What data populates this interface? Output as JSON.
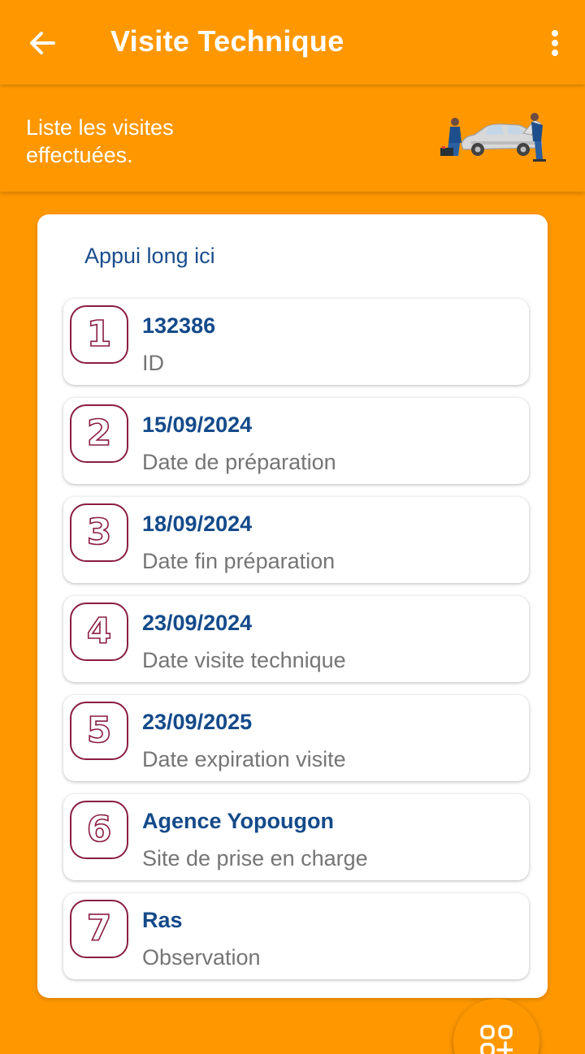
{
  "app_bar": {
    "title": "Visite Technique",
    "back_icon": "arrow-left-icon",
    "menu_icon": "more-vertical-icon"
  },
  "banner": {
    "text": "Liste les visites effectuées.",
    "illustration": "car-mechanics-illustration"
  },
  "card": {
    "hint": "Appui long ici",
    "items": [
      {
        "number": "1",
        "value": "132386",
        "label": "ID"
      },
      {
        "number": "2",
        "value": "15/09/2024",
        "label": "Date de préparation"
      },
      {
        "number": "3",
        "value": "18/09/2024",
        "label": "Date fin préparation"
      },
      {
        "number": "4",
        "value": "23/09/2024",
        "label": "Date visite technique"
      },
      {
        "number": "5",
        "value": "23/09/2025",
        "label": "Date expiration visite"
      },
      {
        "number": "6",
        "value": "Agence Yopougon",
        "label": "Site de prise en charge"
      },
      {
        "number": "7",
        "value": "Ras",
        "label": "Observation"
      }
    ]
  },
  "fab": {
    "icon": "grid-add-icon"
  },
  "colors": {
    "primary": "#FF9800",
    "value_text": "#144A8A",
    "label_text": "#757575",
    "badge_outline": "#8A1D44"
  }
}
